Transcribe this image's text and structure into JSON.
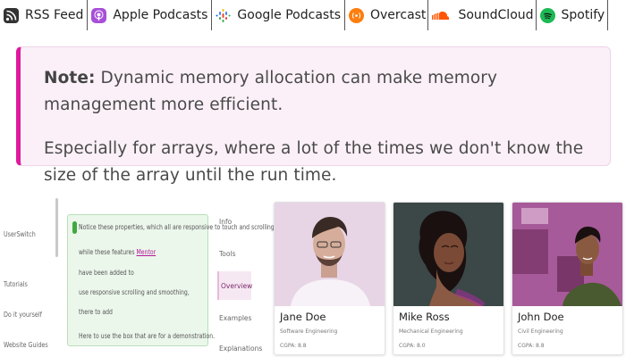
{
  "podcasts": [
    {
      "label": "RSS Feed",
      "icon": "rss-icon",
      "color": "#333333"
    },
    {
      "label": "Apple Podcasts",
      "icon": "apple-podcasts-icon",
      "color": "#b150e2"
    },
    {
      "label": "Google Podcasts",
      "icon": "google-podcasts-icon",
      "color": "#4285f4"
    },
    {
      "label": "Overcast",
      "icon": "overcast-icon",
      "color": "#fc7e0f"
    },
    {
      "label": "SoundCloud",
      "icon": "soundcloud-icon",
      "color": "#ff5500"
    },
    {
      "label": "Spotify",
      "icon": "spotify-icon",
      "color": "#1db954"
    }
  ],
  "note": {
    "label": "Note:",
    "line1": "Dynamic memory allocation can make memory management more efficient.",
    "line2": "Especially for arrays, where a lot of the times we don't know the size of the array until the run time."
  },
  "nav": {
    "items": [
      "UserSwitch",
      "Tutorials",
      "Do it yourself",
      "Website Guides"
    ]
  },
  "green_box": {
    "lines": [
      "Notice these properties, which all are responsive to touch and scrolling,",
      "while these features",
      "have been added to",
      "use responsive scrolling and smoothing,",
      "there to add"
    ],
    "link": "Mentor",
    "below": "Here to use the box that are for a demonstration."
  },
  "tabs": [
    "Info",
    "Tools",
    "Overview",
    "Examples",
    "Explanations"
  ],
  "active_tab": 2,
  "cards": [
    {
      "name": "Jane Doe",
      "role": "Software Engineering",
      "gpa": "CGPA: 8.8"
    },
    {
      "name": "Mike Ross",
      "role": "Mechanical Engineering",
      "gpa": "CGPA: 8.0"
    },
    {
      "name": "John Doe",
      "role": "Civil Engineering",
      "gpa": "CGPA: 8.8"
    }
  ],
  "colors": {
    "accent": "#e0189e",
    "note_bg": "#fbf0f8",
    "card_overlay": "#b02aa8"
  }
}
